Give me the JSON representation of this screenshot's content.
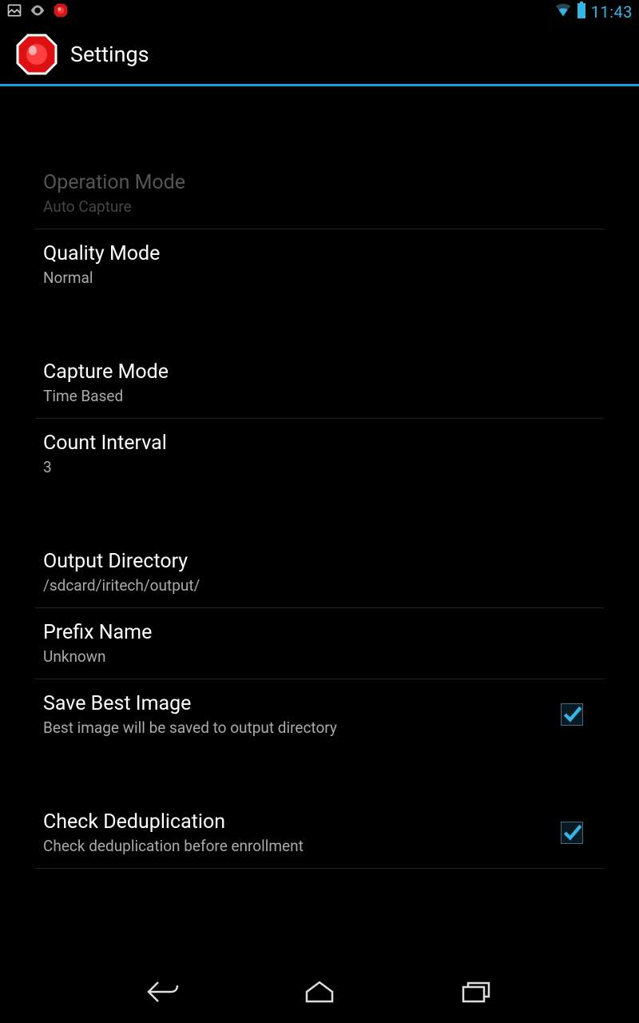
{
  "status": {
    "time": "11:43"
  },
  "header": {
    "title": "Settings"
  },
  "settings": {
    "operation_mode": {
      "title": "Operation Mode",
      "value": "Auto Capture"
    },
    "quality_mode": {
      "title": "Quality Mode",
      "value": "Normal"
    },
    "capture_mode": {
      "title": "Capture Mode",
      "value": "Time Based"
    },
    "count_interval": {
      "title": "Count Interval",
      "value": "3"
    },
    "output_directory": {
      "title": "Output Directory",
      "value": "/sdcard/iritech/output/"
    },
    "prefix_name": {
      "title": "Prefix Name",
      "value": "Unknown"
    },
    "save_best_image": {
      "title": "Save Best Image",
      "value": "Best image will be saved to output directory",
      "checked": true
    },
    "check_dedup": {
      "title": "Check Deduplication",
      "value": "Check deduplication before enrollment",
      "checked": true
    }
  }
}
